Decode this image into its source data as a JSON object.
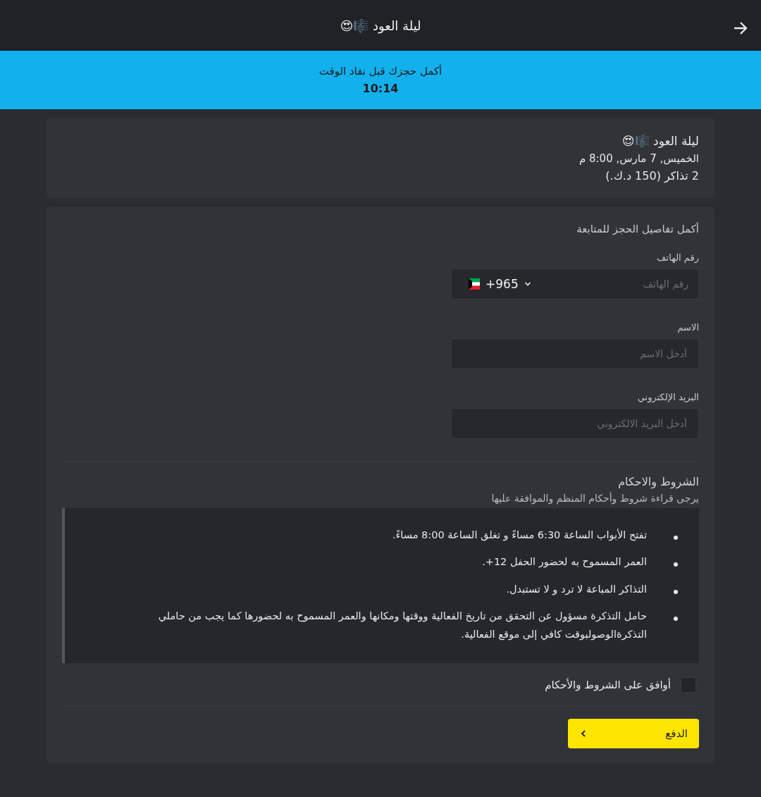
{
  "header": {
    "title": "ليلة العود 🎼😍"
  },
  "timer_banner": {
    "message": "أكمل حجزك قبل نفاد الوقت",
    "time": "10:14"
  },
  "event_summary": {
    "title": "ليلة العود 🎼😍",
    "date": "الخميس, 7 مارس, 8:00 م",
    "tickets": "2 تذاكر (150 د.ك.)"
  },
  "form": {
    "heading": "أكمل تفاصيل الحجز للمتابعة",
    "fields": [
      {
        "kind": "phone",
        "label": "رقم الهاتف",
        "placeholder": "رقم الهاتف",
        "country_code": "+965"
      },
      {
        "kind": "text",
        "label": "الاسم",
        "placeholder": "أدخل الاسم"
      },
      {
        "kind": "text",
        "label": "البريد الإلكتروني",
        "placeholder": "أدخل البريد الالكتروني"
      }
    ]
  },
  "terms": {
    "title": "الشروط والاحكام",
    "subtitle": "يرجى قراءة شروط وأحكام المنظم والموافقة عليها",
    "items": [
      "تفتح الأبواب الساعة 6:30 مساءً و تغلق الساعة 8:00 مساءً.",
      "العمر المسموح به لحضور الحفل 12+.",
      "التذاكر المباعة لا ترد و لا تستبدل.",
      "حامل التذكرة مسؤول عن التحقق من تاريخ الفعالية ووقتها ومكانها والعمر المسموح به لحضورها كما يجب من حاملي التذكرةالوصولبوقت كافي إلى موقع الفعالية."
    ],
    "agree": {
      "label": "أوافق على الشروط والأحكام",
      "checked": false
    }
  },
  "pay_button": {
    "label": "الدفع"
  }
}
